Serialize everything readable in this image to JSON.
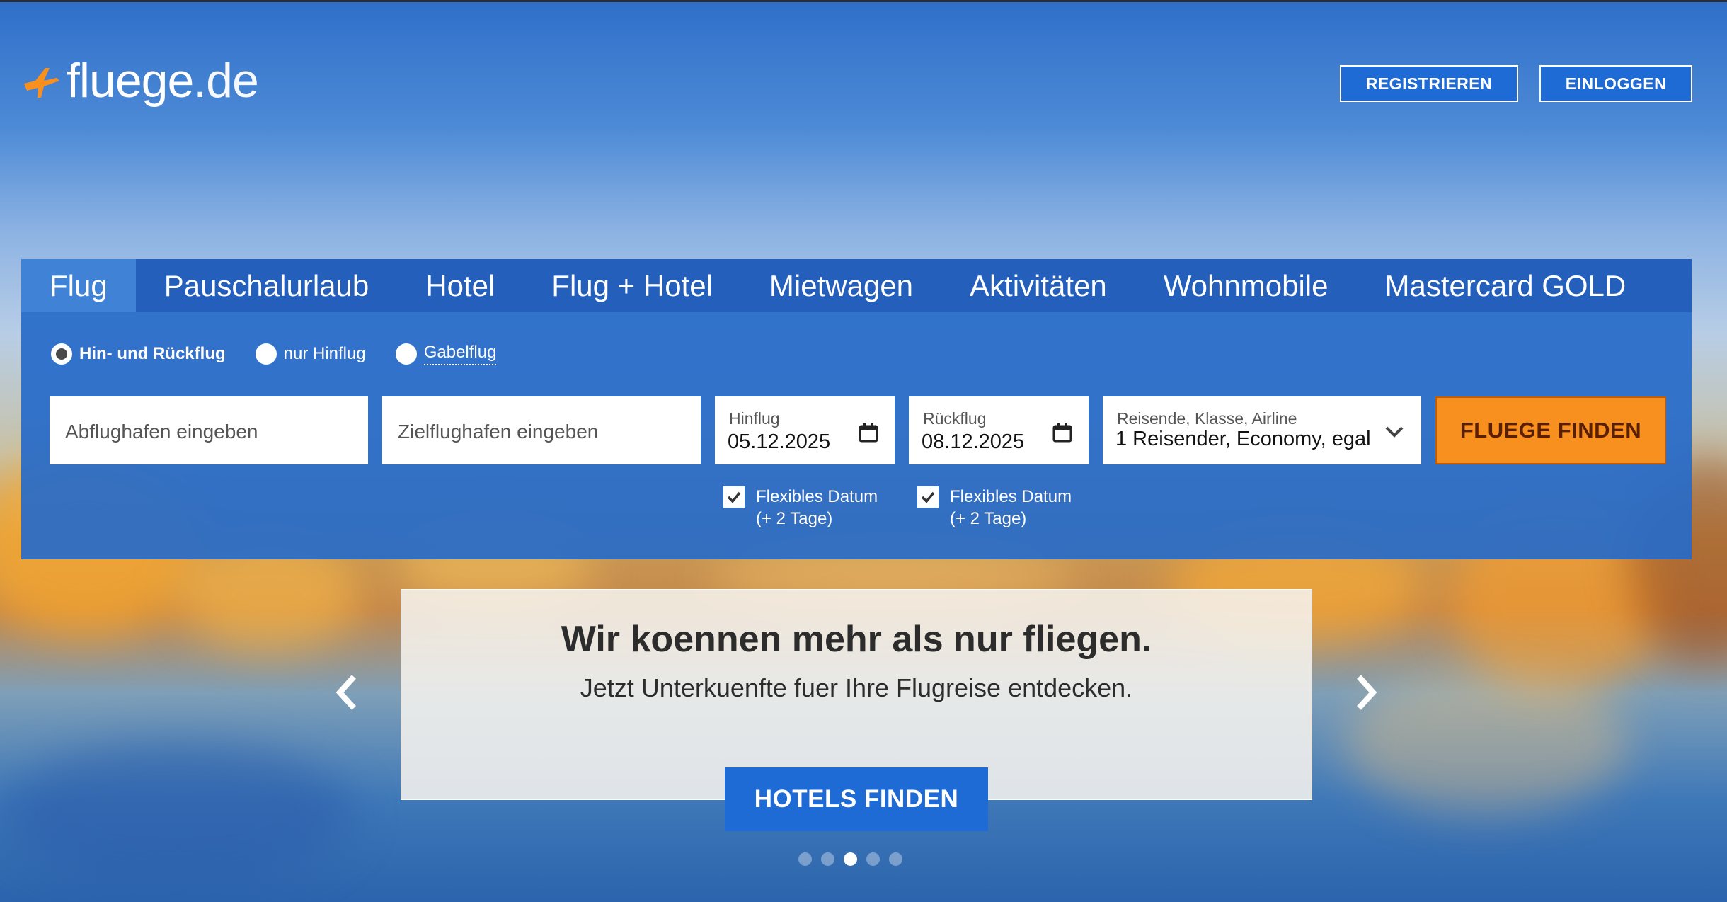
{
  "header": {
    "logo_main": "fluege",
    "logo_tld": ".de",
    "register_label": "REGISTRIEREN",
    "login_label": "EINLOGGEN"
  },
  "tabs": [
    {
      "label": "Flug",
      "active": true
    },
    {
      "label": "Pauschalurlaub"
    },
    {
      "label": "Hotel"
    },
    {
      "label": "Flug + Hotel"
    },
    {
      "label": "Mietwagen"
    },
    {
      "label": "Aktivitäten"
    },
    {
      "label": "Wohnmobile"
    },
    {
      "label": "Mastercard GOLD"
    }
  ],
  "trip_type": {
    "options": [
      {
        "label": "Hin- und Rückflug",
        "selected": true
      },
      {
        "label": "nur Hinflug",
        "selected": false
      },
      {
        "label": "Gabelflug",
        "selected": false
      }
    ]
  },
  "search": {
    "origin_placeholder": "Abflughafen eingeben",
    "destination_placeholder": "Zielflughafen eingeben",
    "outbound_label": "Hinflug",
    "outbound_date": "05.12.2025",
    "return_label": "Rückflug",
    "return_date": "08.12.2025",
    "travelers_label": "Reisende, Klasse, Airline",
    "travelers_value": "1 Reisender, Economy, egal",
    "submit_label": "FLUEGE FINDEN",
    "flex_outbound": {
      "line1": "Flexibles Datum",
      "line2": "(+ 2 Tage)",
      "checked": true
    },
    "flex_return": {
      "line1": "Flexibles Datum",
      "line2": "(+ 2 Tage)",
      "checked": true
    }
  },
  "promo": {
    "title": "Wir koennen mehr als nur fliegen.",
    "subtitle": "Jetzt Unterkuenfte fuer Ihre Flugreise entdecken.",
    "button_label": "HOTELS FINDEN",
    "slide_count": 5,
    "active_slide": 3
  },
  "colors": {
    "brand_blue": "#1f6bd6",
    "cta_orange": "#f7901e",
    "logo_orange": "#f7901e"
  }
}
